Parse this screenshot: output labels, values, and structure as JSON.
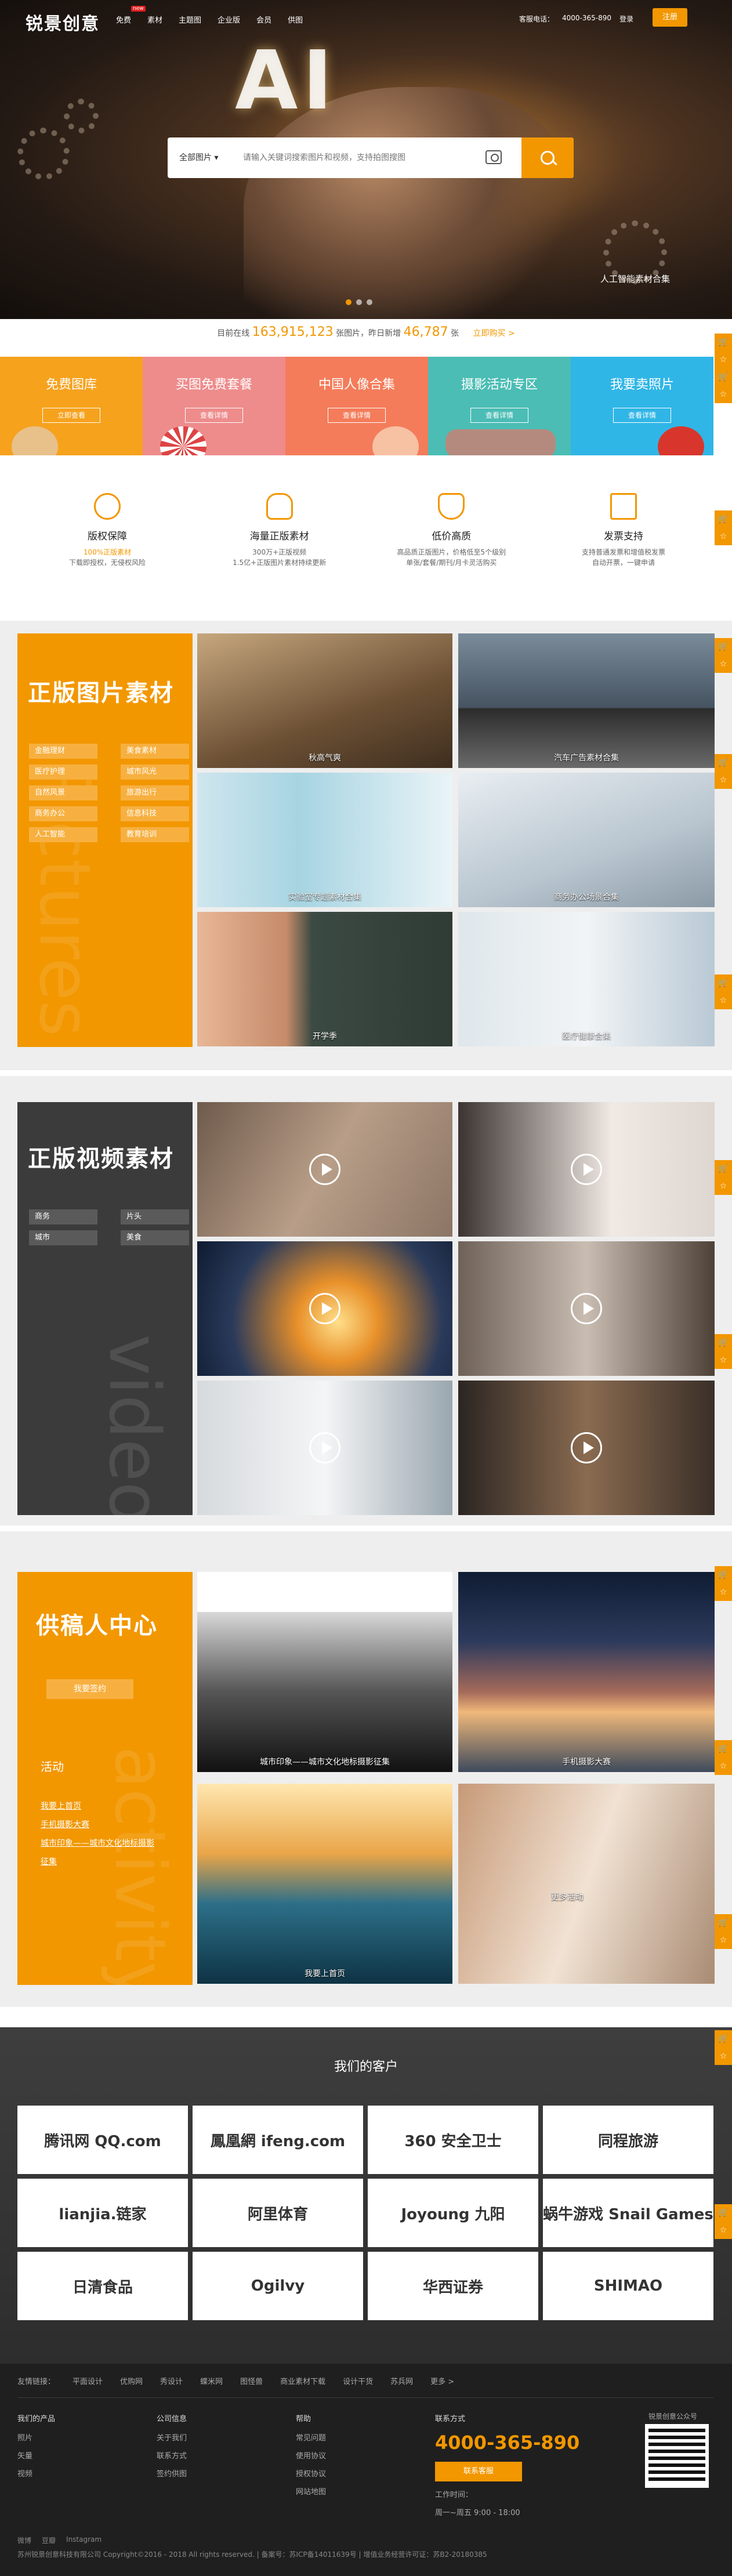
{
  "header": {
    "logo": "锐景创意",
    "nav": [
      "免费",
      "素材",
      "主题图",
      "企业版",
      "会员",
      "供图"
    ],
    "nav_badge": "new",
    "top_right": [
      "客服电话：",
      "4000-365-890",
      "登录",
      "注册"
    ],
    "login_btn": "注册"
  },
  "hero": {
    "headline": "AI",
    "search_category": "全部图片",
    "search_placeholder": "请输入关键词搜索图片和视频，支持拍图搜图",
    "caption": "人工智能素材合集"
  },
  "stats": {
    "prefix": "目前在线",
    "total": "163,915,123",
    "mid": "张图片，昨日新增",
    "new": "46,787",
    "suffix": "张",
    "link": "立即购买 >"
  },
  "tiles": [
    {
      "title": "免费图库",
      "btn": "立即查看",
      "color": "#f6a21d"
    },
    {
      "title": "买图免费套餐",
      "btn": "查看详情",
      "color": "#ee8c8c"
    },
    {
      "title": "中国人像合集",
      "btn": "查看详情",
      "color": "#f47c5a"
    },
    {
      "title": "摄影活动专区",
      "btn": "查看详情",
      "color": "#4bbdb5"
    },
    {
      "title": "我要卖照片",
      "btn": "查看详情",
      "color": "#30b6e6"
    }
  ],
  "features": [
    {
      "title": "版权保障",
      "line1": "100%正版素材",
      "line2": "下载即授权，无侵权风险"
    },
    {
      "title": "海量正版素材",
      "line1": "300万+正版视频",
      "line2": "1.5亿+正版图片素材持续更新"
    },
    {
      "title": "低价高质",
      "line1": "高品质正版图片，价格低至5个级别",
      "line2": "单张/套餐/期刊/月卡灵活购买"
    },
    {
      "title": "发票支持",
      "line1": "支持普通发票和增值税发票",
      "line2": "自动开票，一键申请"
    }
  ],
  "images": {
    "title": "正版图片素材",
    "bg_word": "Pictures",
    "tags": [
      "金融理财",
      "美食素材",
      "医疗护理",
      "城市风光",
      "自然风景",
      "旅游出行",
      "商务办公",
      "信息科技",
      "人工智能",
      "教育培训"
    ],
    "photos": [
      "秋高气爽",
      "汽车广告素材合集",
      "实验室专题素材合集",
      "商务办公场景合集",
      "开学季",
      "医疗健康合集"
    ]
  },
  "videos": {
    "title": "正版视频素材",
    "bg_word": "video",
    "tags": [
      "商务",
      "片头",
      "城市",
      "美食"
    ]
  },
  "contrib": {
    "title": "供稿人中心",
    "bg_word": "activity",
    "btn": "我要签约",
    "activity_title": "活动",
    "activities": [
      "我要上首页",
      "手机摄影大赛",
      "城市印象——城市文化地标摄影",
      "征集"
    ],
    "photos": [
      "城市印象——城市文化地标摄影征集",
      "手机摄影大赛",
      "我要上首页",
      "更多活动"
    ]
  },
  "clients": {
    "title": "我们的客户",
    "logos": [
      "腾讯网 QQ.com",
      "鳳凰網 ifeng.com",
      "360 安全卫士",
      "同程旅游",
      "lianjia.链家",
      "阿里体育",
      "Joyoung 九阳",
      "蜗牛游戏 Snail Games",
      "日清食品",
      "Ogilvy",
      "华西证券",
      "SHIMAO"
    ]
  },
  "footer": {
    "friend_links": [
      "友情链接：",
      "平面设计",
      "优购网",
      "秀设计",
      "蝶米网",
      "图怪兽",
      "商业素材下载",
      "设计干货",
      "苏兵网",
      "更多 >"
    ],
    "col1": {
      "h": "我们的产品",
      "items": [
        "照片",
        "矢量",
        "视频"
      ]
    },
    "col2": {
      "h": "公司信息",
      "items": [
        "关于我们",
        "联系方式",
        "签约供图"
      ]
    },
    "col3": {
      "h": "帮助",
      "items": [
        "常见问题",
        "使用协议",
        "授权协议",
        "网站地图"
      ]
    },
    "col4": {
      "h": "联系方式",
      "phone": "4000-365-890",
      "btn": "联系客服",
      "hours_h": "工作时间：",
      "hours": "周一~周五 9:00 - 18:00"
    },
    "qr_label": "锐景创意公众号",
    "bottom_links": [
      "微博",
      "豆瓣",
      "Instagram"
    ],
    "copyright": "苏州锐景创意科技有限公司 Copyright©2016 - 2018  All rights reserved. | 备案号：苏ICP备14011639号 | 增值业务经营许可证：苏B2-20180385"
  },
  "sidebar_icons": [
    "cart-icon",
    "star-icon",
    "cart-icon",
    "star-icon"
  ]
}
